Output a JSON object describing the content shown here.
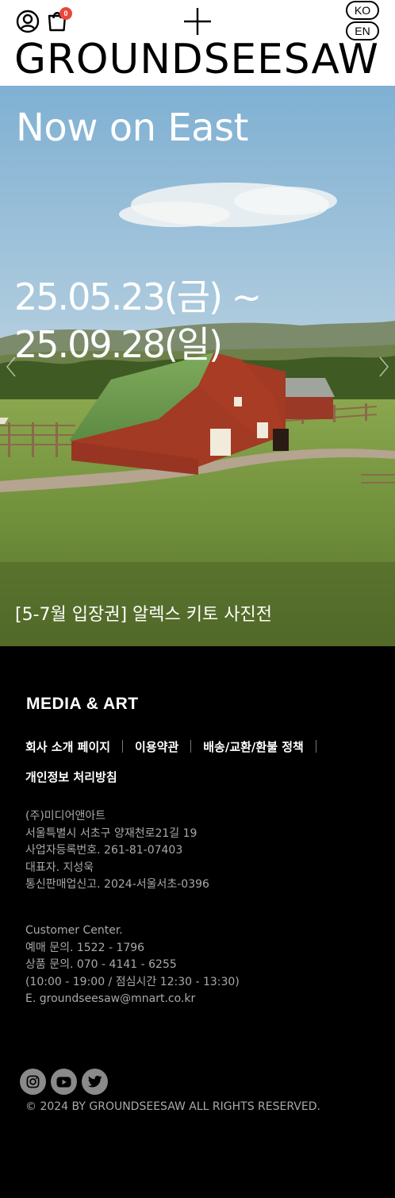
{
  "header": {
    "cart_count": "0",
    "lang_ko": "KO",
    "lang_en": "EN",
    "logo": "GROUNDSEESAW"
  },
  "hero": {
    "headline": "Now on East",
    "date_start": "25.05.23(금) ~",
    "date_end": "25.09.28(일)",
    "title": "[5-7월 입장권] 알렉스 키토 사진전"
  },
  "footer": {
    "brand": "MEDIA & ART",
    "links": [
      "회사 소개 페이지",
      "이용약관",
      "배송/교환/환불 정책",
      "개인정보 처리방침"
    ],
    "company": [
      "(주)미디어앤아트",
      "서울특별시 서초구 양재천로21길 19",
      "사업자등록번호. 261-81-07403",
      "대표자. 지성욱",
      "통신판매업신고. 2024-서울서초-0396"
    ],
    "customer_center": [
      "Customer Center.",
      "예매 문의. 1522 - 1796",
      "상품 문의. 070 - 4141 - 6255",
      "(10:00 - 19:00 / 점심시간 12:30 - 13:30)",
      "E. groundseesaw@mnart.co.kr"
    ],
    "social_icons": [
      "instagram-icon",
      "youtube-icon",
      "twitter-icon"
    ],
    "copyright": "© 2024 BY GROUNDSEESAW ALL RIGHTS RESERVED."
  }
}
